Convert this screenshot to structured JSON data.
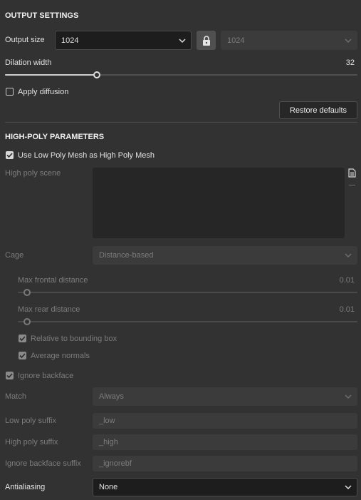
{
  "output_settings": {
    "title": "OUTPUT SETTINGS",
    "output_size_label": "Output size",
    "output_size_value": "1024",
    "output_size_linked_value": "1024",
    "dilation_label": "Dilation width",
    "dilation_value": "32",
    "dilation_fraction": 0.26,
    "apply_diffusion_label": "Apply diffusion",
    "apply_diffusion_checked": false,
    "restore_defaults_label": "Restore defaults"
  },
  "high_poly": {
    "title": "HIGH-POLY PARAMETERS",
    "use_low_poly_label": "Use Low Poly Mesh as High Poly Mesh",
    "use_low_poly_checked": true,
    "scene_label": "High poly scene",
    "cage_label": "Cage",
    "cage_value": "Distance-based",
    "max_frontal_label": "Max frontal distance",
    "max_frontal_value": "0.01",
    "max_rear_label": "Max rear distance",
    "max_rear_value": "0.01",
    "relative_bbox_label": "Relative to bounding box",
    "relative_bbox_checked": true,
    "average_normals_label": "Average normals",
    "average_normals_checked": true,
    "ignore_backface_label": "Ignore backface",
    "ignore_backface_checked": true,
    "match_label": "Match",
    "match_value": "Always",
    "low_suffix_label": "Low poly suffix",
    "low_suffix_value": "_low",
    "high_suffix_label": "High poly suffix",
    "high_suffix_value": "_high",
    "ignorebf_suffix_label": "Ignore backface suffix",
    "ignorebf_suffix_value": "_ignorebf",
    "antialiasing_label": "Antialiasing",
    "antialiasing_value": "None"
  },
  "icons": {
    "lock": "lock-icon",
    "file": "file-icon",
    "remove": "minus-icon",
    "dropdown": "chevron-down-icon",
    "check": "checkmark-icon"
  },
  "colors": {
    "background": "#323232",
    "field_active": "#1d1d1d",
    "field_disabled": "#3b3b3b",
    "text": "#e2e2e2",
    "text_disabled": "#7c7c7c"
  }
}
